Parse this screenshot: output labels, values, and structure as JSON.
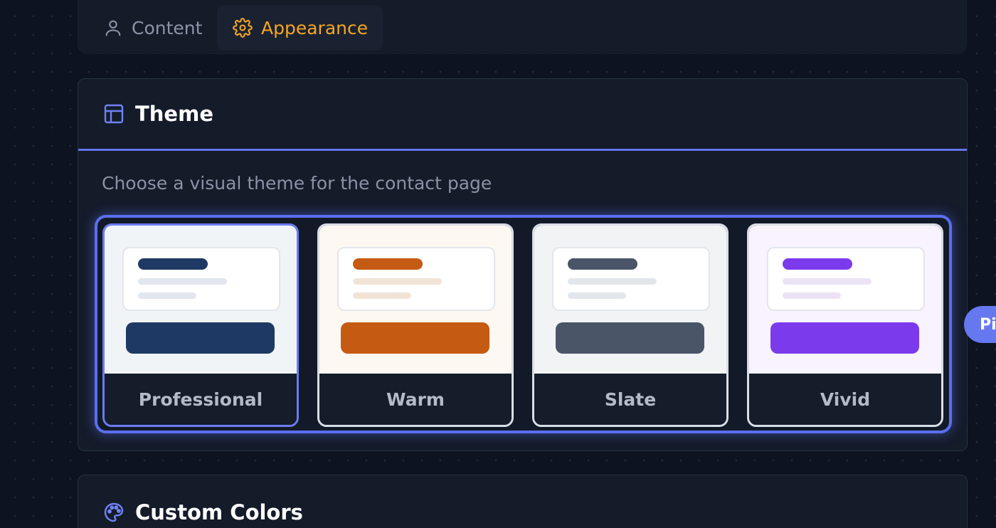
{
  "tabs": [
    {
      "label": "Content",
      "icon": "user-icon",
      "active": false
    },
    {
      "label": "Appearance",
      "icon": "gear-icon",
      "active": true
    }
  ],
  "theme_section": {
    "title": "Theme",
    "icon": "layout-icon",
    "subtitle": "Choose a visual theme for the contact page",
    "themes": [
      {
        "name": "Professional",
        "bg": "#f1f4f7",
        "accent": "#1e3a64",
        "line1": "#e2e6ee",
        "line2": "#e2e6ee",
        "selected": true
      },
      {
        "name": "Warm",
        "bg": "#fdf8f2",
        "accent": "#c55a13",
        "line1": "#f1e4d7",
        "line2": "#f1e4d7",
        "selected": false
      },
      {
        "name": "Slate",
        "bg": "#f2f3f5",
        "accent": "#4a5568",
        "line1": "#e3e6ea",
        "line2": "#e3e6ea",
        "selected": false
      },
      {
        "name": "Vivid",
        "bg": "#f8f3fd",
        "accent": "#7c3aed",
        "line1": "#ebe3f5",
        "line2": "#ebe3f5",
        "selected": false
      }
    ]
  },
  "colors_section": {
    "title": "Custom Colors",
    "icon": "palette-icon"
  },
  "floating_pill": {
    "label": "Pi"
  },
  "colors": {
    "accent": "#f5a524",
    "primary": "#6373e8",
    "background": "#0d1320",
    "panel": "#141b29"
  }
}
